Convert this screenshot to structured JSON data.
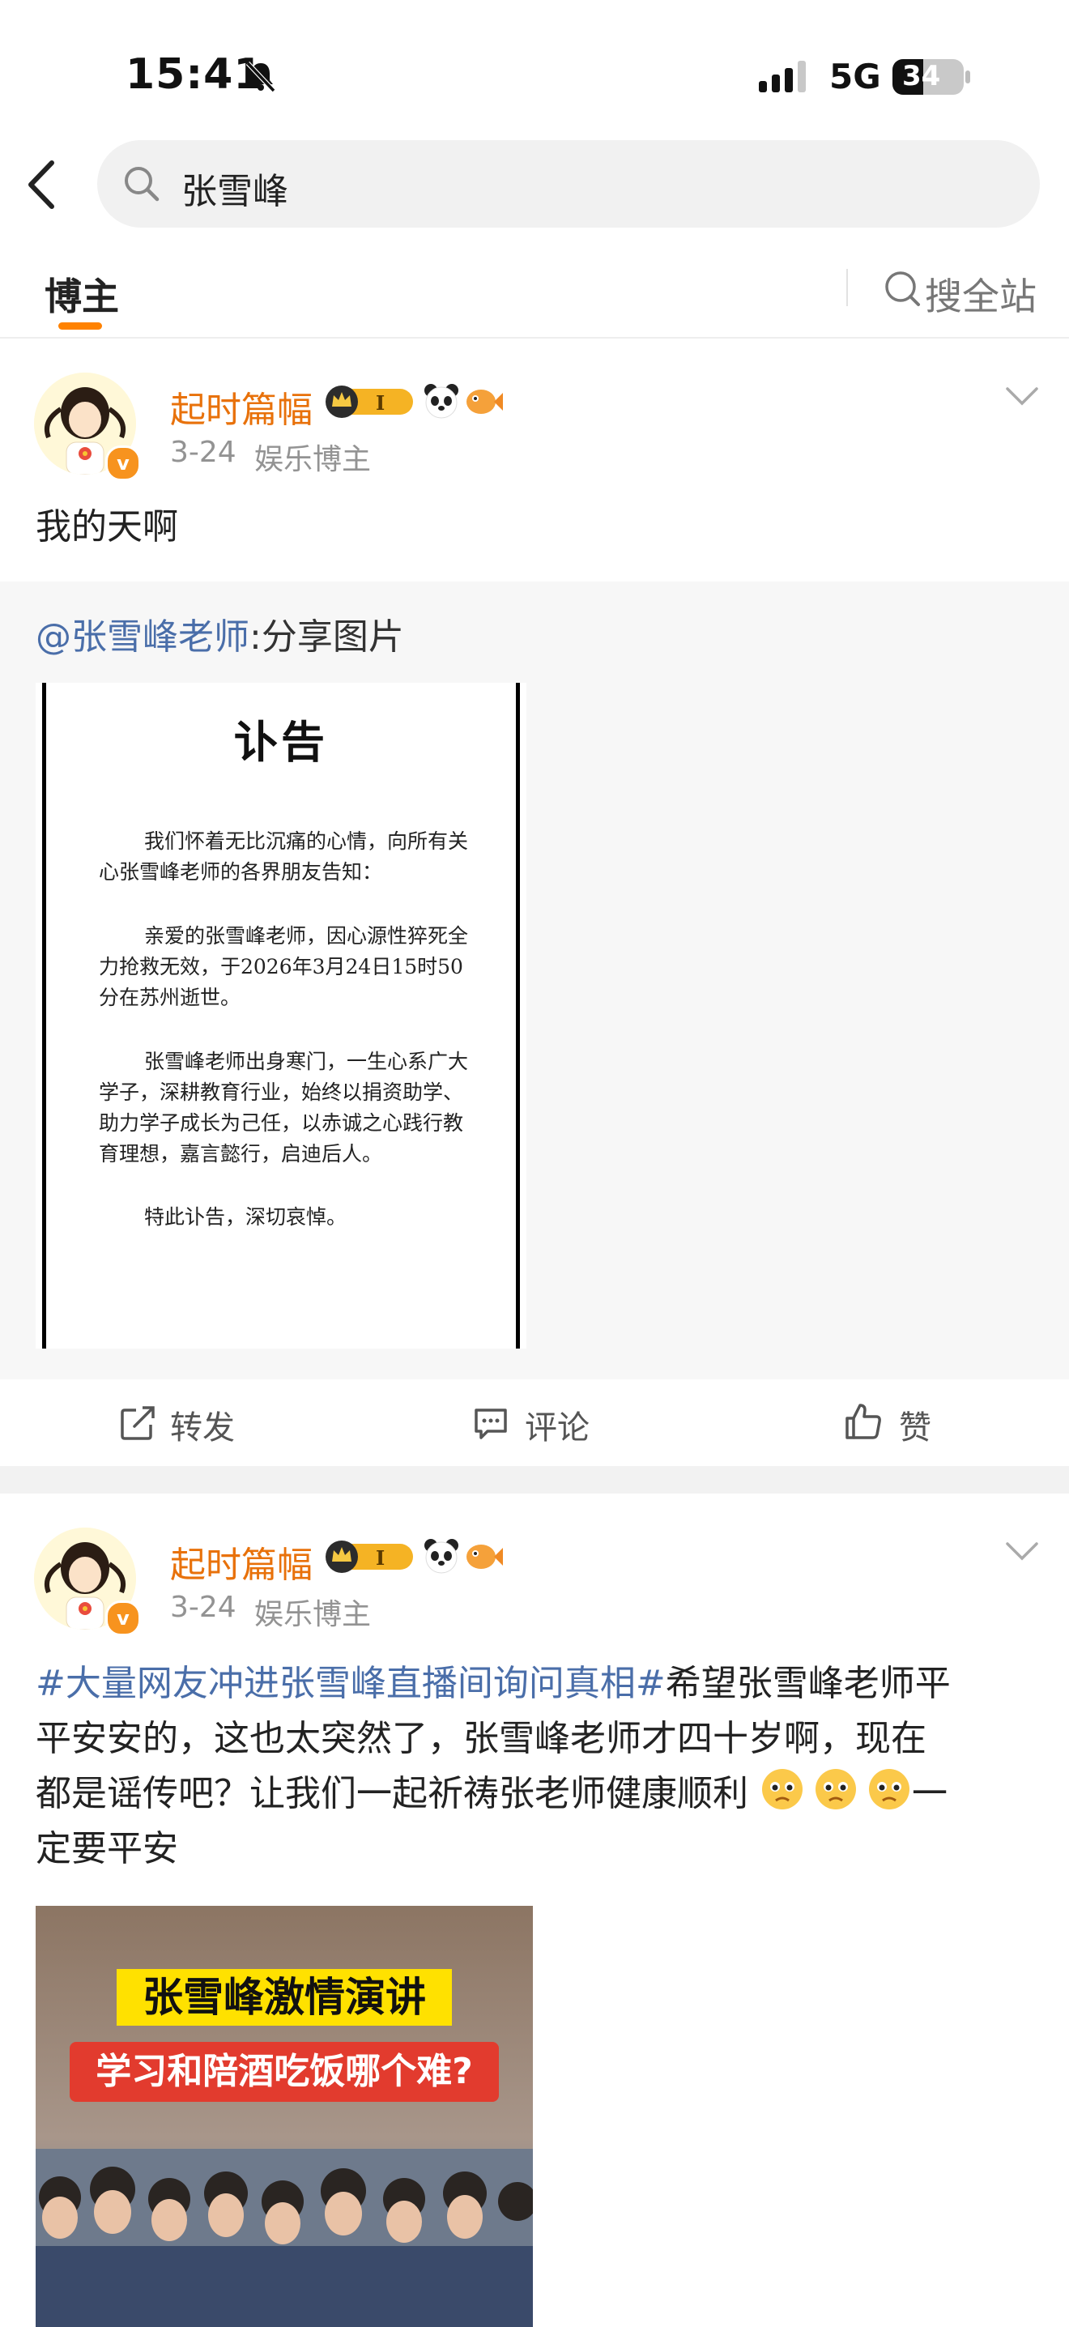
{
  "status_bar": {
    "time": "15:41",
    "network": "5G",
    "battery": "34"
  },
  "search": {
    "query": "张雪峰"
  },
  "tabs": {
    "active": "博主",
    "site_search": "搜全站"
  },
  "posts": [
    {
      "username": "起时篇幅",
      "level_badge": "I",
      "date": "3-24",
      "category": "娱乐博主",
      "text": "我的天啊",
      "repost": {
        "mention": "@张雪峰老师",
        "suffix": ":分享图片",
        "image": {
          "title": "讣告",
          "paragraphs": [
            "我们怀着无比沉痛的心情，向所有关心张雪峰老师的各界朋友告知：",
            "亲爱的张雪峰老师，因心源性猝死全力抢救无效，于2026年3月24日15时50分在苏州逝世。",
            "张雪峰老师出身寒门，一生心系广大学子，深耕教育行业，始终以捐资助学、助力学子成长为己任，以赤诚之心践行教育理想，嘉言懿行，启迪后人。",
            "特此讣告，深切哀悼。"
          ]
        }
      },
      "actions": {
        "repost": "转发",
        "comment": "评论",
        "like": "赞"
      }
    },
    {
      "username": "起时篇幅",
      "level_badge": "I",
      "date": "3-24",
      "category": "娱乐博主",
      "hashtag": "#大量网友冲进张雪峰直播间询问真相#",
      "text_line1": "希望张雪峰老师平",
      "text_line2": "平安安的，这也太突然了，张雪峰老师才四十岁啊，现在",
      "text_line3_a": "都是谣传吧？让我们一起祈祷张老师健康顺利",
      "text_line3_b": "一",
      "text_line4": "定要平安",
      "image": {
        "caption1": "张雪峰激情演讲",
        "caption2": "学习和陪酒吃饭哪个难?"
      }
    }
  ],
  "colors": {
    "accent": "#ff8200",
    "username": "#e8710a",
    "link": "#4a6ea9",
    "meta": "#939393"
  }
}
